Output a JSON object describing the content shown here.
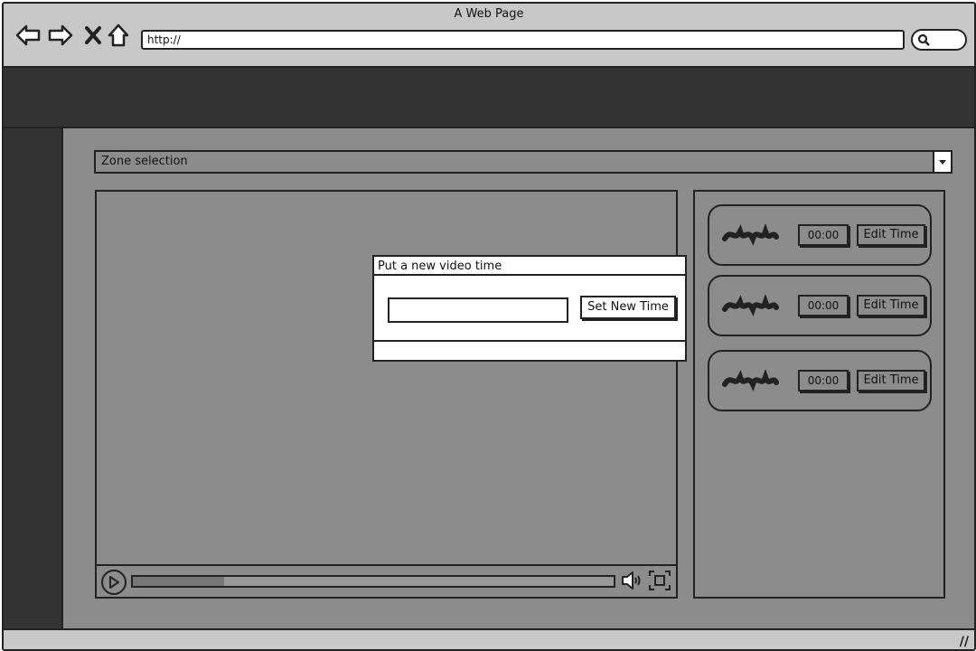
{
  "window": {
    "title": "A Web Page"
  },
  "nav": {
    "back_icon": "arrow-left-icon",
    "forward_icon": "arrow-right-icon",
    "stop_icon": "close-icon",
    "home_icon": "home-icon"
  },
  "address_bar": {
    "value": "http://"
  },
  "search": {
    "icon": "search-icon"
  },
  "zone_select": {
    "selected": "Zone selection",
    "icon": "chevron-down-icon"
  },
  "video_player": {
    "progress": 0.19,
    "play_icon": "play-icon",
    "volume_icon": "volume-icon",
    "fullscreen_icon": "fullscreen-icon"
  },
  "dialog": {
    "title": "Put a new video time",
    "input_value": "",
    "button_label": "Set New Time"
  },
  "time_entries": [
    {
      "time": "00:00",
      "edit_label": "Edit Time"
    },
    {
      "time": "00:00",
      "edit_label": "Edit Time"
    },
    {
      "time": "00:00",
      "edit_label": "Edit Time"
    }
  ],
  "colors": {
    "chrome": "#c8c8c8",
    "dark": "#333333",
    "canvas": "#8c8c8c",
    "ink": "#222222"
  }
}
